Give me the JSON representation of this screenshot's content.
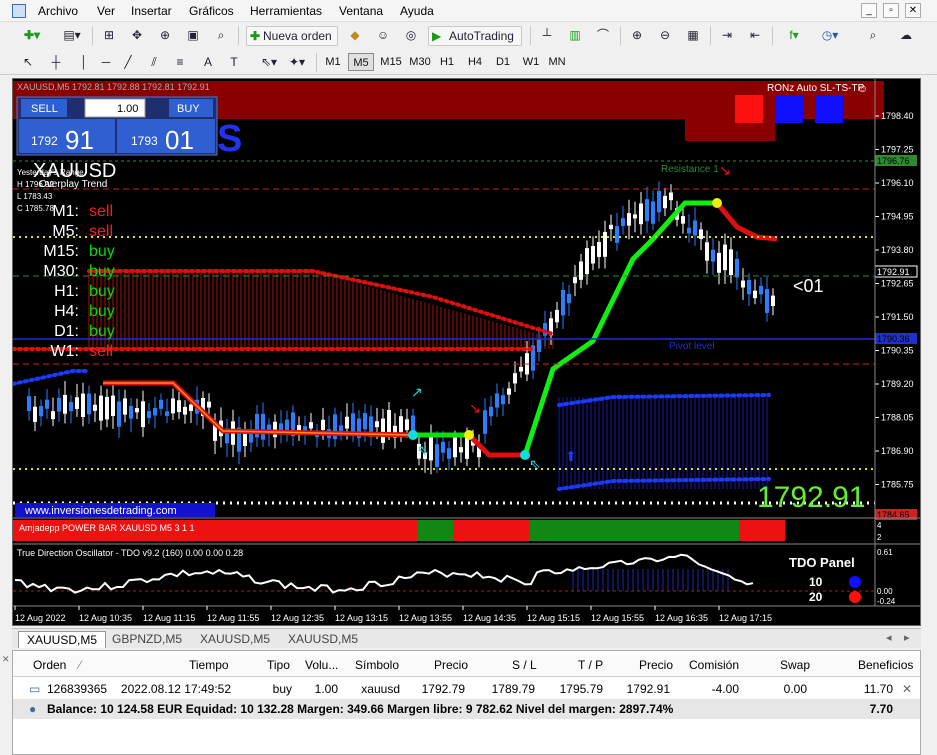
{
  "menu": {
    "items": [
      "Archivo",
      "Ver",
      "Insertar",
      "Gráficos",
      "Herramientas",
      "Ventana",
      "Ayuda"
    ]
  },
  "toolbar": {
    "new_order_label": "Nueva orden",
    "autotrading_label": "AutoTrading",
    "timeframes": [
      "M1",
      "M5",
      "M15",
      "M30",
      "H1",
      "H4",
      "D1",
      "W1",
      "MN"
    ],
    "active_timeframe": "M5"
  },
  "chart": {
    "header_text": "XAUUSD,M5 1792.81 1792.88 1792.81 1792.91",
    "top_right_label": "RONz Auto SL-TS-TP",
    "trade_panel": {
      "sell_label": "SELL",
      "buy_label": "BUY",
      "lot": "1.00",
      "sell_price_small": "1792",
      "sell_price_big": "91",
      "buy_price_small": "1793",
      "buy_price_big": "01"
    },
    "symbol": "XAUUSD",
    "info_lines": [
      "Yesterday's Range",
      "H 1796.92",
      "L 1783.43",
      "C 1785.78"
    ],
    "overlay_trend": "Overplay Trend",
    "trend": [
      {
        "tf": "M1:",
        "signal": "sell"
      },
      {
        "tf": "M5:",
        "signal": "sell"
      },
      {
        "tf": "M15:",
        "signal": "buy"
      },
      {
        "tf": "M30:",
        "signal": "buy"
      },
      {
        "tf": "H1:",
        "signal": "buy"
      },
      {
        "tf": "H4:",
        "signal": "buy"
      },
      {
        "tf": "D1:",
        "signal": "buy"
      },
      {
        "tf": "W1:",
        "signal": "sell"
      }
    ],
    "price_axis": [
      "1798.40",
      "1797.25",
      "1796.10",
      "1794.95",
      "1793.80",
      "1792.65",
      "1791.50",
      "1790.35",
      "1789.20",
      "1788.05",
      "1786.90",
      "1785.75"
    ],
    "current_price_tag": "1792.91",
    "resistance_tag": "1796.76",
    "pivot_tag": "1790.36",
    "bottom_tag": "1784.65",
    "resistance_label": "Resistance 1",
    "pivot_label": "Pivot level",
    "arrow_label": "<01",
    "big_price": "1792.91",
    "website": "www.inversionesdetrading.com",
    "powerbar_label": "Amjadepp POWER BAR XAUUSD M5 3 1 1",
    "powerbar_axis": [
      "4",
      "2"
    ],
    "tdo_label": "True Direction Oscillator - TDO v9.2 (160) 0.00 0.00 0.28",
    "tdo_panel_title": "TDO Panel",
    "tdo_values": [
      "10",
      "20"
    ],
    "tdo_axis": [
      "0.61",
      "0.00",
      "-0.24"
    ],
    "time_axis": [
      "12 Aug 2022",
      "12 Aug 10:35",
      "12 Aug 11:15",
      "12 Aug 11:55",
      "12 Aug 12:35",
      "12 Aug 13:15",
      "12 Aug 13:55",
      "12 Aug 14:35",
      "12 Aug 15:15",
      "12 Aug 15:55",
      "12 Aug 16:35",
      "12 Aug 17:15"
    ]
  },
  "tabs": [
    "XAUUSD,M5",
    "GBPNZD,M5",
    "XAUUSD,M5",
    "XAUUSD,M5"
  ],
  "terminal": {
    "headers": [
      "Orden",
      "Tiempo",
      "Tipo",
      "Volu...",
      "Símbolo",
      "Precio",
      "S / L",
      "T / P",
      "Precio",
      "Comisión",
      "Swap",
      "Beneficios"
    ],
    "row": [
      "126839365",
      "2022.08.12 17:49:52",
      "buy",
      "1.00",
      "xauusd",
      "1792.79",
      "1789.79",
      "1795.79",
      "1792.91",
      "-4.00",
      "0.00",
      "11.70"
    ],
    "balance_line": "Balance: 10 124.58 EUR  Equidad: 10 132.28  Margen: 349.66  Margen libre: 9 782.62  Nivel del margen: 2897.74%",
    "balance_profit": "7.70"
  },
  "colors": {
    "up": "#2a7fff",
    "down": "#ff2020",
    "green": "#00cc00",
    "buy": "#00dd00",
    "sell": "#ff1a1a"
  }
}
